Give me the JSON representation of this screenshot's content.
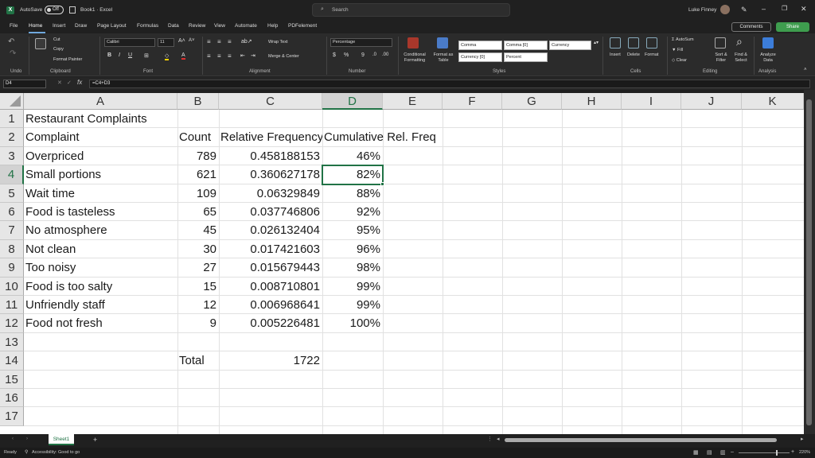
{
  "titlebar": {
    "autosave_label": "AutoSave",
    "autosave_state": "Off",
    "doc_title": "Book1 · Excel",
    "search_placeholder": "Search",
    "user_name": "Luke Finney"
  },
  "menu": {
    "tabs": [
      "File",
      "Home",
      "Insert",
      "Draw",
      "Page Layout",
      "Formulas",
      "Data",
      "Review",
      "View",
      "Automate",
      "Help",
      "PDFelement"
    ],
    "active": "Home",
    "comments_label": "Comments",
    "share_label": "Share"
  },
  "ribbon": {
    "clipboard": {
      "cut": "Cut",
      "copy": "Copy",
      "format_painter": "Format Painter",
      "label": "Clipboard"
    },
    "undo_label": "Undo",
    "font": {
      "name": "Calibri",
      "size": "11",
      "label": "Font"
    },
    "alignment": {
      "wrap_text": "Wrap Text",
      "merge_center": "Merge & Center",
      "label": "Alignment"
    },
    "number": {
      "format": "Percentage",
      "label": "Number"
    },
    "styles": {
      "conditional_formatting": "Conditional Formatting",
      "format_as_table": "Format as Table",
      "cell_styles": [
        "Comma",
        "Comma [0]",
        "Currency",
        "Currency [0]",
        "Percent"
      ],
      "label": "Styles"
    },
    "cells": {
      "insert": "Insert",
      "delete": "Delete",
      "format": "Format",
      "label": "Cells"
    },
    "editing": {
      "autosum": "AutoSum",
      "fill": "Fill",
      "clear": "Clear",
      "sort_filter": "Sort & Filter",
      "find_select": "Find & Select",
      "label": "Editing"
    },
    "analysis": {
      "analyze_data": "Analyze Data",
      "label": "Analysis"
    }
  },
  "formula_bar": {
    "name_box": "D4",
    "formula": "=C4+D3",
    "fx": "fx"
  },
  "sheet": {
    "columns": [
      "A",
      "B",
      "C",
      "D",
      "E",
      "F",
      "G",
      "H",
      "I",
      "J",
      "K"
    ],
    "rows": [
      "1",
      "2",
      "3",
      "4",
      "5",
      "6",
      "7",
      "8",
      "9",
      "10",
      "11",
      "12",
      "13",
      "14",
      "15",
      "16",
      "17"
    ],
    "title": "Restaurant Complaints",
    "headers": {
      "a": "Complaint",
      "b": "Count",
      "c": "Relative Frequency",
      "d": "Cumulative Rel. Freq"
    },
    "data_rows": [
      {
        "a": "Overpriced",
        "b": "789",
        "c": "0.458188153",
        "d": "46%"
      },
      {
        "a": "Small portions",
        "b": "621",
        "c": "0.360627178",
        "d": "82%"
      },
      {
        "a": "Wait time",
        "b": "109",
        "c": "0.06329849",
        "d": "88%"
      },
      {
        "a": "Food is tasteless",
        "b": "65",
        "c": "0.037746806",
        "d": "92%"
      },
      {
        "a": "No atmosphere",
        "b": "45",
        "c": "0.026132404",
        "d": "95%"
      },
      {
        "a": "Not clean",
        "b": "30",
        "c": "0.017421603",
        "d": "96%"
      },
      {
        "a": "Too noisy",
        "b": "27",
        "c": "0.015679443",
        "d": "98%"
      },
      {
        "a": "Food is too salty",
        "b": "15",
        "c": "0.008710801",
        "d": "99%"
      },
      {
        "a": "Unfriendly staff",
        "b": "12",
        "c": "0.006968641",
        "d": "99%"
      },
      {
        "a": "Food not fresh",
        "b": "9",
        "c": "0.005226481",
        "d": "100%"
      }
    ],
    "total_label": "Total",
    "total_value": "1722",
    "selected_cell": "D4"
  },
  "tabs": {
    "sheet_name": "Sheet1",
    "add_sheet": "+"
  },
  "statusbar": {
    "ready": "Ready",
    "accessibility": "Accessibility: Good to go",
    "zoom": "220%"
  },
  "colors": {
    "accent": "#217346",
    "share": "#3e9d4e"
  }
}
